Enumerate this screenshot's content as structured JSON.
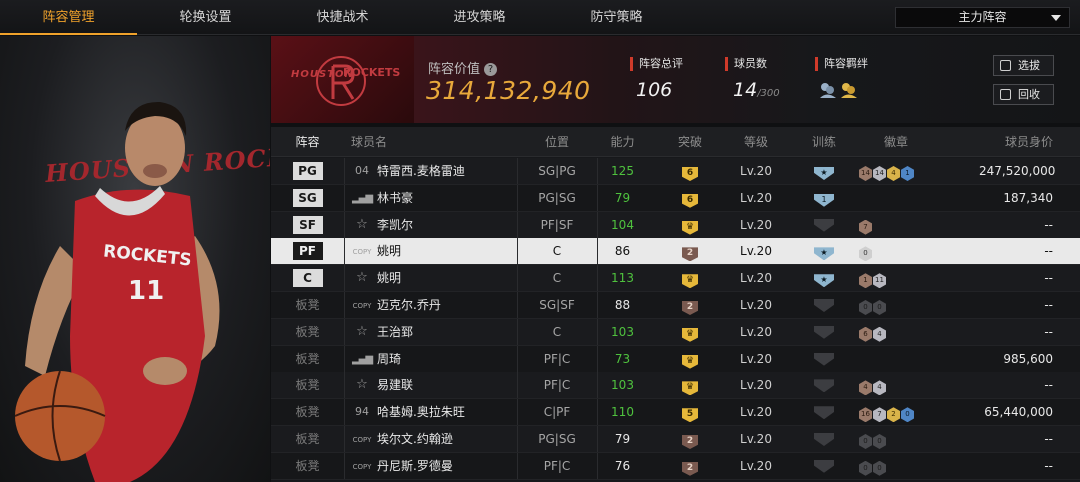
{
  "nav": {
    "tabs": [
      "阵容管理",
      "轮换设置",
      "快捷战术",
      "进攻策略",
      "防守策略"
    ],
    "active_tab": 0,
    "dropdown_value": "主力阵容"
  },
  "hero": {
    "jersey_text": "ROCKETS",
    "jersey_number": "11",
    "bg_text": "HOUSTON ROCKETS"
  },
  "team": {
    "logo_text_left": "HOUSTON",
    "logo_text_right": "ROCKETS"
  },
  "summary": {
    "value_label": "阵容价值",
    "value": "314,132,940",
    "rating_label": "阵容总评",
    "rating": "106",
    "count_label": "球员数",
    "count": "14",
    "count_max": "/300",
    "bond_label": "阵容羁绊",
    "btn_select": "选拔",
    "btn_recycle": "回收"
  },
  "table": {
    "headers": [
      "阵容",
      "球员名",
      "位置",
      "能力",
      "突破",
      "等级",
      "训练",
      "徽章",
      "球员身价"
    ],
    "rows": [
      {
        "slot": "PG",
        "icon": "04",
        "name": "特雷西.麦格雷迪",
        "pos": "SG|PG",
        "ability": "125",
        "ability_color": "green",
        "break": "6",
        "break_style": "gold",
        "level": "Lv.20",
        "train": "star",
        "train_style": "blue",
        "badges": [
          [
            "14",
            "bronze"
          ],
          [
            "14",
            "silver"
          ],
          [
            "4",
            "gold"
          ],
          [
            "1",
            "blue"
          ]
        ],
        "value": "247,520,000"
      },
      {
        "slot": "SG",
        "icon": "bars",
        "name": "林书豪",
        "pos": "PG|SG",
        "ability": "79",
        "ability_color": "green",
        "break": "6",
        "break_style": "gold",
        "level": "Lv.20",
        "train": "1",
        "train_style": "blue",
        "badges": [],
        "value": "187,340"
      },
      {
        "slot": "SF",
        "icon": "star",
        "name": "李凯尔",
        "pos": "PF|SF",
        "ability": "104",
        "ability_color": "green",
        "break": "♛",
        "break_style": "gold",
        "level": "Lv.20",
        "train": "",
        "train_style": "grey",
        "badges": [
          [
            "7",
            "bronze"
          ]
        ],
        "value": "--"
      },
      {
        "slot": "PF",
        "icon": "copy",
        "name": "姚明",
        "pos": "C",
        "ability": "86",
        "ability_color": "white",
        "break": "2",
        "break_style": "brown",
        "level": "Lv.20",
        "train": "★",
        "train_style": "blue",
        "badges": [
          [
            "0",
            "grey"
          ]
        ],
        "value": "--",
        "selected": true
      },
      {
        "slot": "C",
        "icon": "star",
        "name": "姚明",
        "pos": "C",
        "ability": "113",
        "ability_color": "green",
        "break": "♛",
        "break_style": "gold",
        "level": "Lv.20",
        "train": "★",
        "train_style": "blue",
        "badges": [
          [
            "1",
            "bronze"
          ],
          [
            "11",
            "silver"
          ]
        ],
        "value": "--"
      },
      {
        "slot": "板凳",
        "icon": "copy",
        "name": "迈克尔.乔丹",
        "pos": "SG|SF",
        "ability": "88",
        "ability_color": "white",
        "break": "2",
        "break_style": "brown",
        "level": "Lv.20",
        "train": "",
        "train_style": "grey",
        "badges": [
          [
            "0",
            "dark"
          ],
          [
            "0",
            "dark"
          ]
        ],
        "value": "--"
      },
      {
        "slot": "板凳",
        "icon": "star",
        "name": "王治郅",
        "pos": "C",
        "ability": "103",
        "ability_color": "green",
        "break": "♛",
        "break_style": "gold",
        "level": "Lv.20",
        "train": "",
        "train_style": "grey",
        "badges": [
          [
            "6",
            "bronze"
          ],
          [
            "4",
            "silver"
          ]
        ],
        "value": "--"
      },
      {
        "slot": "板凳",
        "icon": "bars",
        "name": "周琦",
        "pos": "PF|C",
        "ability": "73",
        "ability_color": "green",
        "break": "♛",
        "break_style": "gold",
        "level": "Lv.20",
        "train": "",
        "train_style": "grey",
        "badges": [],
        "value": "985,600"
      },
      {
        "slot": "板凳",
        "icon": "star",
        "name": "易建联",
        "pos": "PF|C",
        "ability": "103",
        "ability_color": "green",
        "break": "♛",
        "break_style": "gold",
        "level": "Lv.20",
        "train": "",
        "train_style": "grey",
        "badges": [
          [
            "4",
            "bronze"
          ],
          [
            "4",
            "silver"
          ]
        ],
        "value": "--"
      },
      {
        "slot": "板凳",
        "icon": "94",
        "name": "哈基姆.奥拉朱旺",
        "pos": "C|PF",
        "ability": "110",
        "ability_color": "green",
        "break": "5",
        "break_style": "gold",
        "level": "Lv.20",
        "train": "",
        "train_style": "grey",
        "badges": [
          [
            "16",
            "bronze"
          ],
          [
            "7",
            "silver"
          ],
          [
            "2",
            "gold"
          ],
          [
            "0",
            "blue"
          ]
        ],
        "value": "65,440,000"
      },
      {
        "slot": "板凳",
        "icon": "copy",
        "name": "埃尔文.约翰逊",
        "pos": "PG|SG",
        "ability": "79",
        "ability_color": "white",
        "break": "2",
        "break_style": "brown",
        "level": "Lv.20",
        "train": "",
        "train_style": "grey",
        "badges": [
          [
            "0",
            "dark"
          ],
          [
            "0",
            "dark"
          ]
        ],
        "value": "--"
      },
      {
        "slot": "板凳",
        "icon": "copy",
        "name": "丹尼斯.罗德曼",
        "pos": "PF|C",
        "ability": "76",
        "ability_color": "white",
        "break": "2",
        "break_style": "brown",
        "level": "Lv.20",
        "train": "",
        "train_style": "grey",
        "badges": [
          [
            "0",
            "dark"
          ],
          [
            "0",
            "dark"
          ]
        ],
        "value": "--"
      }
    ]
  }
}
